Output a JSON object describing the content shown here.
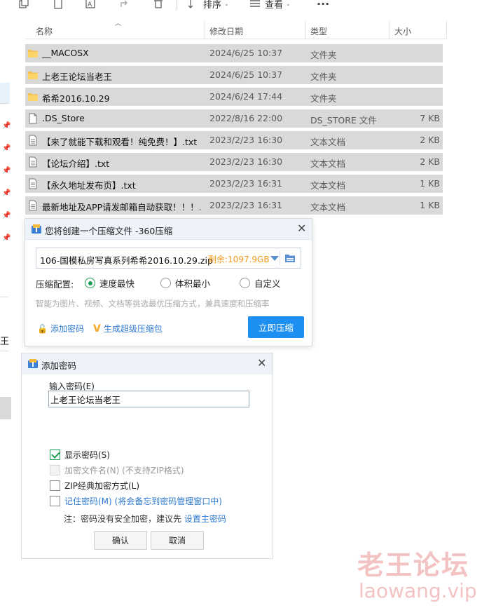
{
  "toolbar": {
    "sort_label": "排序",
    "view_label": "查看",
    "more_label": "···"
  },
  "columns": {
    "name": "名称",
    "date": "修改日期",
    "type": "类型",
    "size": "大小"
  },
  "files": [
    {
      "name": "__MACOSX",
      "date": "2024/6/25 10:37",
      "type": "文件夹",
      "size": "",
      "kind": "folder"
    },
    {
      "name": "上老王论坛当老王",
      "date": "2024/6/25 10:37",
      "type": "文件夹",
      "size": "",
      "kind": "folder"
    },
    {
      "name": "希希2016.10.29",
      "date": "2024/6/24 17:44",
      "type": "文件夹",
      "size": "",
      "kind": "folder"
    },
    {
      "name": ".DS_Store",
      "date": "2022/8/16 22:00",
      "type": "DS_STORE 文件",
      "size": "7 KB",
      "kind": "file"
    },
    {
      "name": "【来了就能下载和观看！纯免费！】.txt",
      "date": "2023/2/23 16:30",
      "type": "文本文档",
      "size": "2 KB",
      "kind": "txt"
    },
    {
      "name": "【论坛介绍】.txt",
      "date": "2023/2/23 16:30",
      "type": "文本文档",
      "size": "2 KB",
      "kind": "txt"
    },
    {
      "name": "【永久地址发布页】.txt",
      "date": "2023/2/23 16:31",
      "type": "文本文档",
      "size": "1 KB",
      "kind": "txt"
    },
    {
      "name": "最新地址及APP请发邮箱自动获取！！！....",
      "date": "2023/2/23 16:31",
      "type": "文本文档",
      "size": "1 KB",
      "kind": "txt"
    }
  ],
  "nav": {
    "partial_label": "王"
  },
  "compress_dialog": {
    "title": "您将创建一个压缩文件 -360压缩",
    "filename": "106-国模私房写真系列希希2016.10.29.zip",
    "free_space": "剩余:1097.9GB",
    "config_label": "压缩配置:",
    "options": [
      "速度最快",
      "体积最小",
      "自定义"
    ],
    "selected_option": "速度最快",
    "hint": "智能为图片、视频、文档等挑选最优压缩方式，兼具速度和压缩率",
    "add_password_label": "添加密码",
    "super_zip_label": "生成超级压缩包",
    "compress_button": "立即压缩",
    "accent_color": "#1d8ff0"
  },
  "password_dialog": {
    "title": "添加密码",
    "input_label": "输入密码(E)",
    "password_value": "上老王论坛当老王",
    "show_password_label": "显示密码(S)",
    "show_password_checked": true,
    "encrypt_names_label": "加密文件名(N) (不支持ZIP格式)",
    "zip_classic_label": "ZIP经典加密方式(L)",
    "remember_label": "记住密码(M) (将会备忘到密码管理窗口中)",
    "note_prefix": "注：密码没有安全加密，建议先",
    "note_link": "设置主密码",
    "ok_button": "确认",
    "cancel_button": "取消"
  },
  "watermark": {
    "line1": "老王论坛",
    "line2": "laowang.vip"
  }
}
